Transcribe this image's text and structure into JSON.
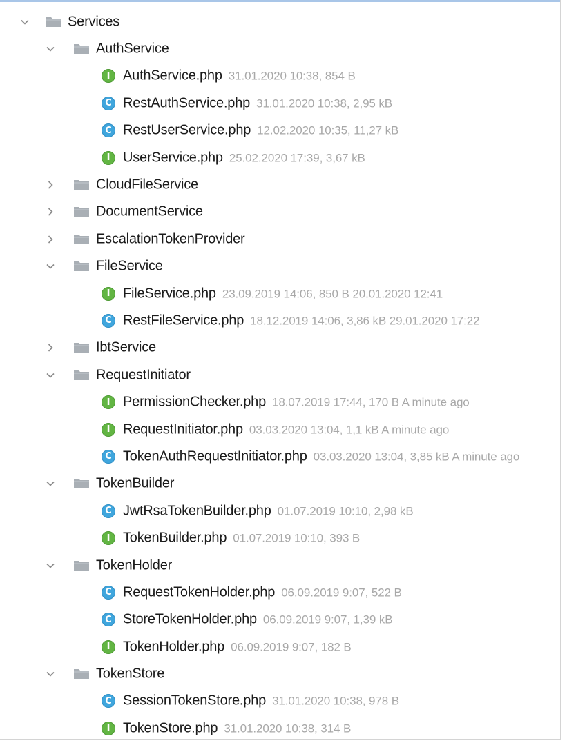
{
  "tree": {
    "root": {
      "name": "Services",
      "expanded": true,
      "icon": "folder-icon"
    },
    "folders": [
      {
        "name": "AuthService",
        "expanded": true,
        "files": [
          {
            "name": "AuthService.php",
            "kind": "interface",
            "badge": "I",
            "meta": "31.01.2020 10:38, 854 B"
          },
          {
            "name": "RestAuthService.php",
            "kind": "class",
            "badge": "C",
            "meta": "31.01.2020 10:38, 2,95 kB"
          },
          {
            "name": "RestUserService.php",
            "kind": "class",
            "badge": "C",
            "meta": "12.02.2020 10:35, 11,27 kB"
          },
          {
            "name": "UserService.php",
            "kind": "interface",
            "badge": "I",
            "meta": "25.02.2020 17:39, 3,67 kB"
          }
        ]
      },
      {
        "name": "CloudFileService",
        "expanded": false,
        "files": []
      },
      {
        "name": "DocumentService",
        "expanded": false,
        "files": []
      },
      {
        "name": "EscalationTokenProvider",
        "expanded": false,
        "files": []
      },
      {
        "name": "FileService",
        "expanded": true,
        "files": [
          {
            "name": "FileService.php",
            "kind": "interface",
            "badge": "I",
            "meta": "23.09.2019 14:06, 850 B 20.01.2020 12:41"
          },
          {
            "name": "RestFileService.php",
            "kind": "class",
            "badge": "C",
            "meta": "18.12.2019 14:06, 3,86 kB 29.01.2020 17:22"
          }
        ]
      },
      {
        "name": "IbtService",
        "expanded": false,
        "files": []
      },
      {
        "name": "RequestInitiator",
        "expanded": true,
        "files": [
          {
            "name": "PermissionChecker.php",
            "kind": "interface",
            "badge": "I",
            "meta": "18.07.2019 17:44, 170 B A minute ago"
          },
          {
            "name": "RequestInitiator.php",
            "kind": "interface",
            "badge": "I",
            "meta": "03.03.2020 13:04, 1,1 kB A minute ago"
          },
          {
            "name": "TokenAuthRequestInitiator.php",
            "kind": "class",
            "badge": "C",
            "meta": "03.03.2020 13:04, 3,85 kB A minute ago"
          }
        ]
      },
      {
        "name": "TokenBuilder",
        "expanded": true,
        "files": [
          {
            "name": "JwtRsaTokenBuilder.php",
            "kind": "class",
            "badge": "C",
            "meta": "01.07.2019 10:10, 2,98 kB"
          },
          {
            "name": "TokenBuilder.php",
            "kind": "interface",
            "badge": "I",
            "meta": "01.07.2019 10:10, 393 B"
          }
        ]
      },
      {
        "name": "TokenHolder",
        "expanded": true,
        "files": [
          {
            "name": "RequestTokenHolder.php",
            "kind": "class",
            "badge": "C",
            "meta": "06.09.2019 9:07, 522 B"
          },
          {
            "name": "StoreTokenHolder.php",
            "kind": "class",
            "badge": "C",
            "meta": "06.09.2019 9:07, 1,39 kB"
          },
          {
            "name": "TokenHolder.php",
            "kind": "interface",
            "badge": "I",
            "meta": "06.09.2019 9:07, 182 B"
          }
        ]
      },
      {
        "name": "TokenStore",
        "expanded": true,
        "files": [
          {
            "name": "SessionTokenStore.php",
            "kind": "class",
            "badge": "C",
            "meta": "31.01.2020 10:38, 978 B"
          },
          {
            "name": "TokenStore.php",
            "kind": "interface",
            "badge": "I",
            "meta": "31.01.2020 10:38, 314 B"
          }
        ]
      }
    ]
  },
  "colors": {
    "interface_badge": "#62b543",
    "class_badge": "#40a6dd",
    "folder": "#a9afb5",
    "meta_text": "#a8a8a8",
    "chevron": "#8c8c8c"
  }
}
